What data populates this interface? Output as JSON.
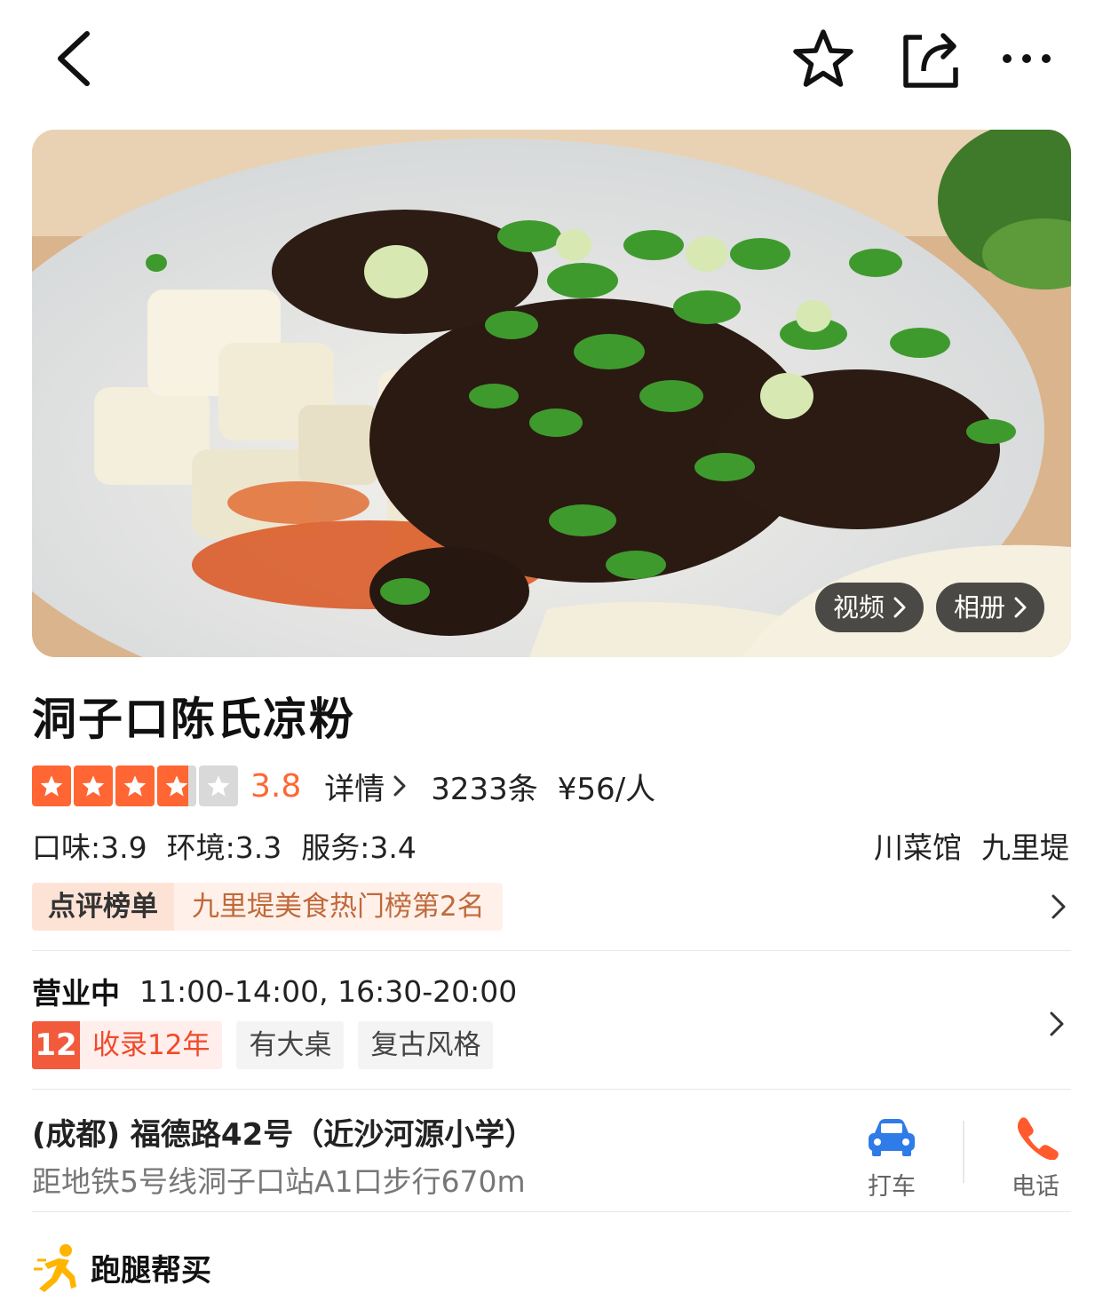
{
  "header": {
    "back_icon": "chevron-left-icon",
    "favorite_icon": "star-outline-icon",
    "share_icon": "share-icon",
    "more_icon": "more-dots-icon"
  },
  "hero": {
    "video_label": "视频",
    "album_label": "相册"
  },
  "shop": {
    "name": "洞子口陈氏凉粉",
    "rating": "3.8",
    "rating_value": 3.8,
    "detail_label": "详情",
    "review_count": "3233条",
    "price_per_person": "¥56/人",
    "taste": "口味:3.9",
    "environment": "环境:3.3",
    "service": "服务:3.4",
    "category": "川菜馆",
    "area": "九里堤"
  },
  "rank": {
    "badge": "点评榜单",
    "text": "九里堤美食热门榜第2名"
  },
  "hours": {
    "status": "营业中",
    "times": "11:00-14:00, 16:30-20:00"
  },
  "tags": {
    "years_number": "12",
    "years_text": "收录12年",
    "items": [
      "有大桌",
      "复古风格"
    ]
  },
  "address": {
    "line": "(成都) 福德路42号（近沙河源小学）",
    "metro": "距地铁5号线洞子口站A1口步行670m",
    "taxi_label": "打车",
    "phone_label": "电话"
  },
  "errand": {
    "label": "跑腿帮买"
  },
  "colors": {
    "accent_orange": "#ff6633",
    "star_filled": "#ff6633",
    "star_empty": "#d9d9d9",
    "taxi_blue": "#2f7be8",
    "phone_orange": "#ff5a2c"
  }
}
